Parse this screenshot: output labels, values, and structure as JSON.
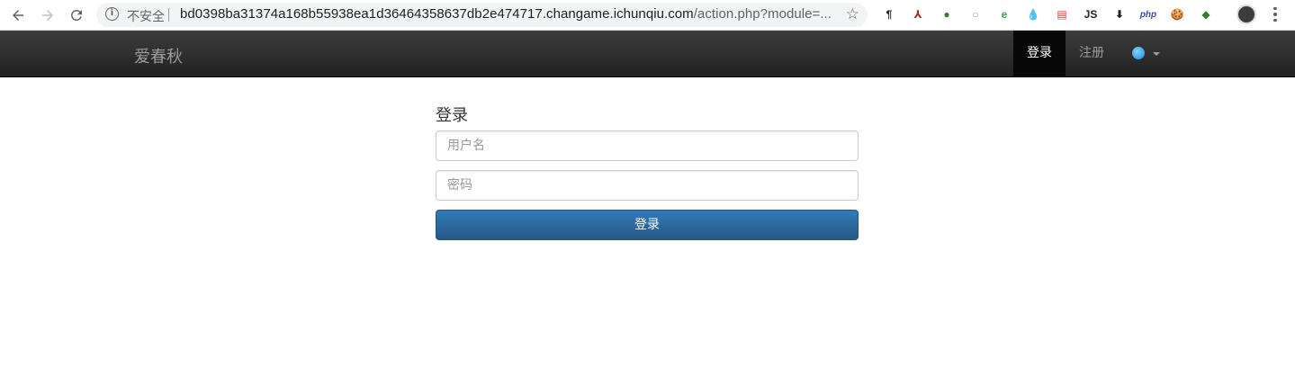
{
  "browser": {
    "security_label": "不安全",
    "url_host": "bd0398ba31374a168b55938ea1d36464358637db2e474717.changame.ichunqiu.com",
    "url_rest": "/action.php?module=...",
    "extensions": [
      {
        "name": "paragraph-ext-icon",
        "glyph": "¶",
        "color": "#202124"
      },
      {
        "name": "pdf-ext-icon",
        "glyph": "⅄",
        "color": "#b3261e"
      },
      {
        "name": "green-ball-ext-icon",
        "glyph": "●",
        "color": "#2e7d32"
      },
      {
        "name": "ring-ext-icon",
        "glyph": "○",
        "color": "#9e9e9e"
      },
      {
        "name": "e-ext-icon",
        "glyph": "e",
        "color": "#43a047"
      },
      {
        "name": "drop-ext-icon",
        "glyph": "💧",
        "color": "#1565c0"
      },
      {
        "name": "red-badge-ext-icon",
        "glyph": "▤",
        "color": "#e53935"
      },
      {
        "name": "js-ext-icon",
        "glyph": "JS",
        "color": "#202124"
      },
      {
        "name": "download-ext-icon",
        "glyph": "⬇",
        "color": "#202124"
      },
      {
        "name": "php-ext-icon",
        "glyph": "php",
        "color": "#3949ab"
      },
      {
        "name": "cookie-ext-icon",
        "glyph": "🍪",
        "color": "#a1887f"
      },
      {
        "name": "globe-ext-icon",
        "glyph": "◆",
        "color": "#2e7d32"
      }
    ]
  },
  "navbar": {
    "brand": "爱春秋",
    "login": "登录",
    "register": "注册",
    "language_icon": "globe-icon"
  },
  "form": {
    "title": "登录",
    "username_placeholder": "用户名",
    "password_placeholder": "密码",
    "submit": "登录"
  },
  "colors": {
    "navbar_bg": "#222222",
    "active_nav_bg": "#080808",
    "primary_button": "#337ab7"
  }
}
